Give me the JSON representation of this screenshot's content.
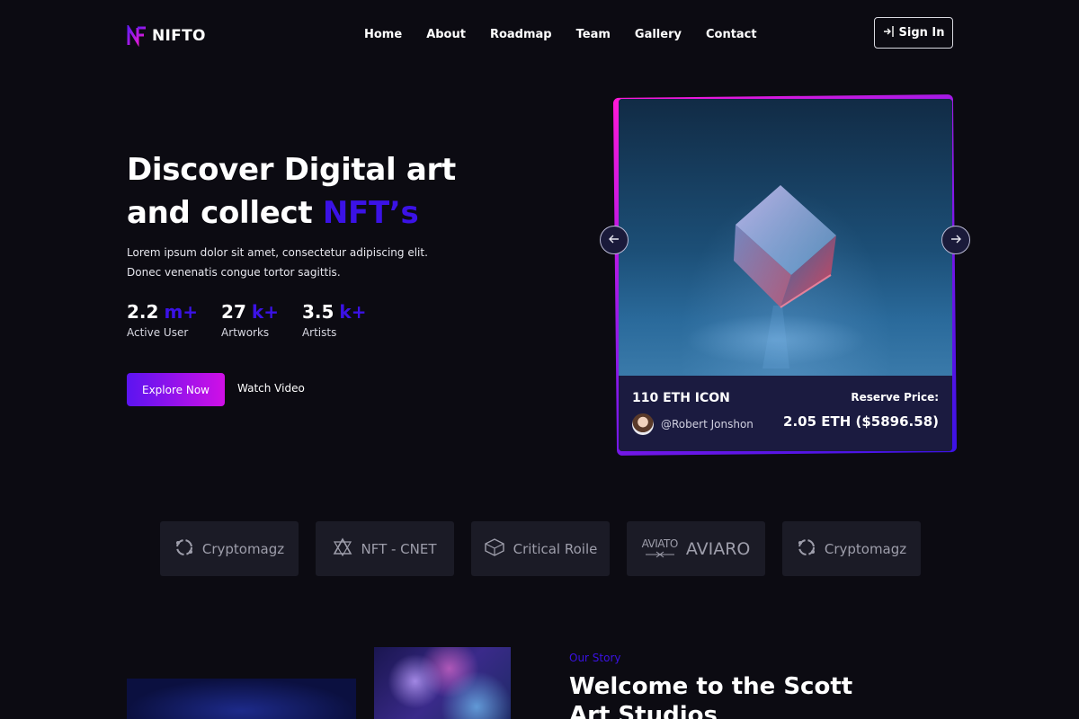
{
  "brand": {
    "name": "NIFTO",
    "logo_icon": "nf-monogram-icon",
    "accent": "#3b12e6",
    "gradient_start": "#5b14f0",
    "gradient_end": "#d010e6"
  },
  "nav": {
    "items": [
      "Home",
      "About",
      "Roadmap",
      "Team",
      "Gallery",
      "Contact"
    ]
  },
  "signin": {
    "label": "Sign In",
    "icon": "login-icon"
  },
  "hero": {
    "title_line1": "Discover Digital art",
    "title_line2_prefix": "and collect ",
    "title_line2_accent": "NFT’s",
    "desc_line1": "Lorem ipsum dolor sit amet, consectetur adipiscing elit.",
    "desc_line2": "Donec venenatis congue tortor sagittis.",
    "stats": [
      {
        "value": "2.2",
        "suffix": "m+",
        "label": "Active User"
      },
      {
        "value": "27",
        "suffix": "k+",
        "label": "Artworks"
      },
      {
        "value": "3.5",
        "suffix": "k+",
        "label": "Artists"
      }
    ],
    "explore_label": "Explore Now",
    "watch_label": "Watch Video"
  },
  "card": {
    "title": "110 ETH ICON",
    "owner": "@Robert Jonshon",
    "reserve_label": "Reserve Price:",
    "reserve_value": "2.05 ETH ($5896.58)"
  },
  "partners": [
    {
      "name": "Cryptomagz",
      "icon": "cryptomagz-icon"
    },
    {
      "name": "NFT - CNET",
      "icon": "nft-cnet-icon"
    },
    {
      "name": "Critical Roile",
      "icon": "critical-roile-icon"
    },
    {
      "name": "AVIARO",
      "icon": "aviato-icon",
      "mark": "AVIATO"
    },
    {
      "name": "Cryptomagz",
      "icon": "cryptomagz-icon"
    }
  ],
  "story": {
    "eyebrow": "Our Story",
    "title": "Welcome to the Scott Art Studios"
  }
}
